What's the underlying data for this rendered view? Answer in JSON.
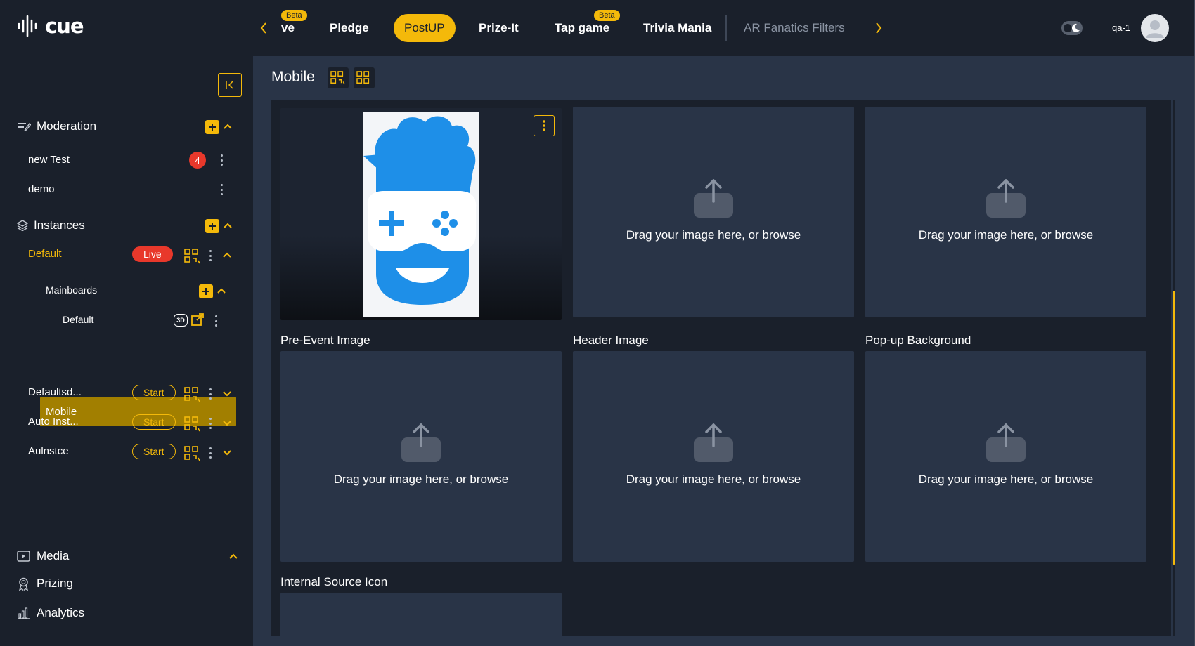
{
  "app": {
    "logo_text": "cue"
  },
  "top_tabs": [
    {
      "label": "ve",
      "beta": "Beta"
    },
    {
      "label": "Pledge"
    },
    {
      "label": "PostUP",
      "active": true
    },
    {
      "label": "Prize-It"
    },
    {
      "label": "Tap game",
      "beta": "Beta"
    },
    {
      "label": "Trivia Mania"
    },
    {
      "label": "AR Fanatics Filters"
    }
  ],
  "user": {
    "name": "qa-1"
  },
  "sidebar": {
    "moderation": {
      "label": "Moderation",
      "items": [
        {
          "label": "new Test",
          "count": "4"
        },
        {
          "label": "demo"
        }
      ]
    },
    "instances": {
      "label": "Instances",
      "items": [
        {
          "label": "Default",
          "status": "Live"
        },
        {
          "label": "Defaultsd...",
          "status": "Start"
        },
        {
          "label": "Auto Inst...",
          "status": "Start"
        },
        {
          "label": "Aulnstce",
          "status": "Start"
        }
      ],
      "mainboards": {
        "label": "Mainboards",
        "default_label": "Default",
        "badge_3d": "3D",
        "selected": "Mobile"
      }
    },
    "bottom": [
      {
        "label": "Media",
        "icon": "media-icon"
      },
      {
        "label": "Prizing",
        "icon": "award-icon"
      },
      {
        "label": "Analytics",
        "icon": "analytics-icon"
      }
    ]
  },
  "main": {
    "title": "Mobile",
    "upload_text": "Drag your image here, or browse",
    "cards": [
      {
        "label": "Pre-Event Image"
      },
      {
        "label": "Header Image"
      },
      {
        "label": "Pop-up Background"
      },
      {
        "label": "Internal Source Icon"
      }
    ]
  },
  "colors": {
    "accent": "#f4b90a",
    "background": "#1a202b",
    "panel": "#293447",
    "live": "#e8382b",
    "selected": "#a27f00"
  }
}
